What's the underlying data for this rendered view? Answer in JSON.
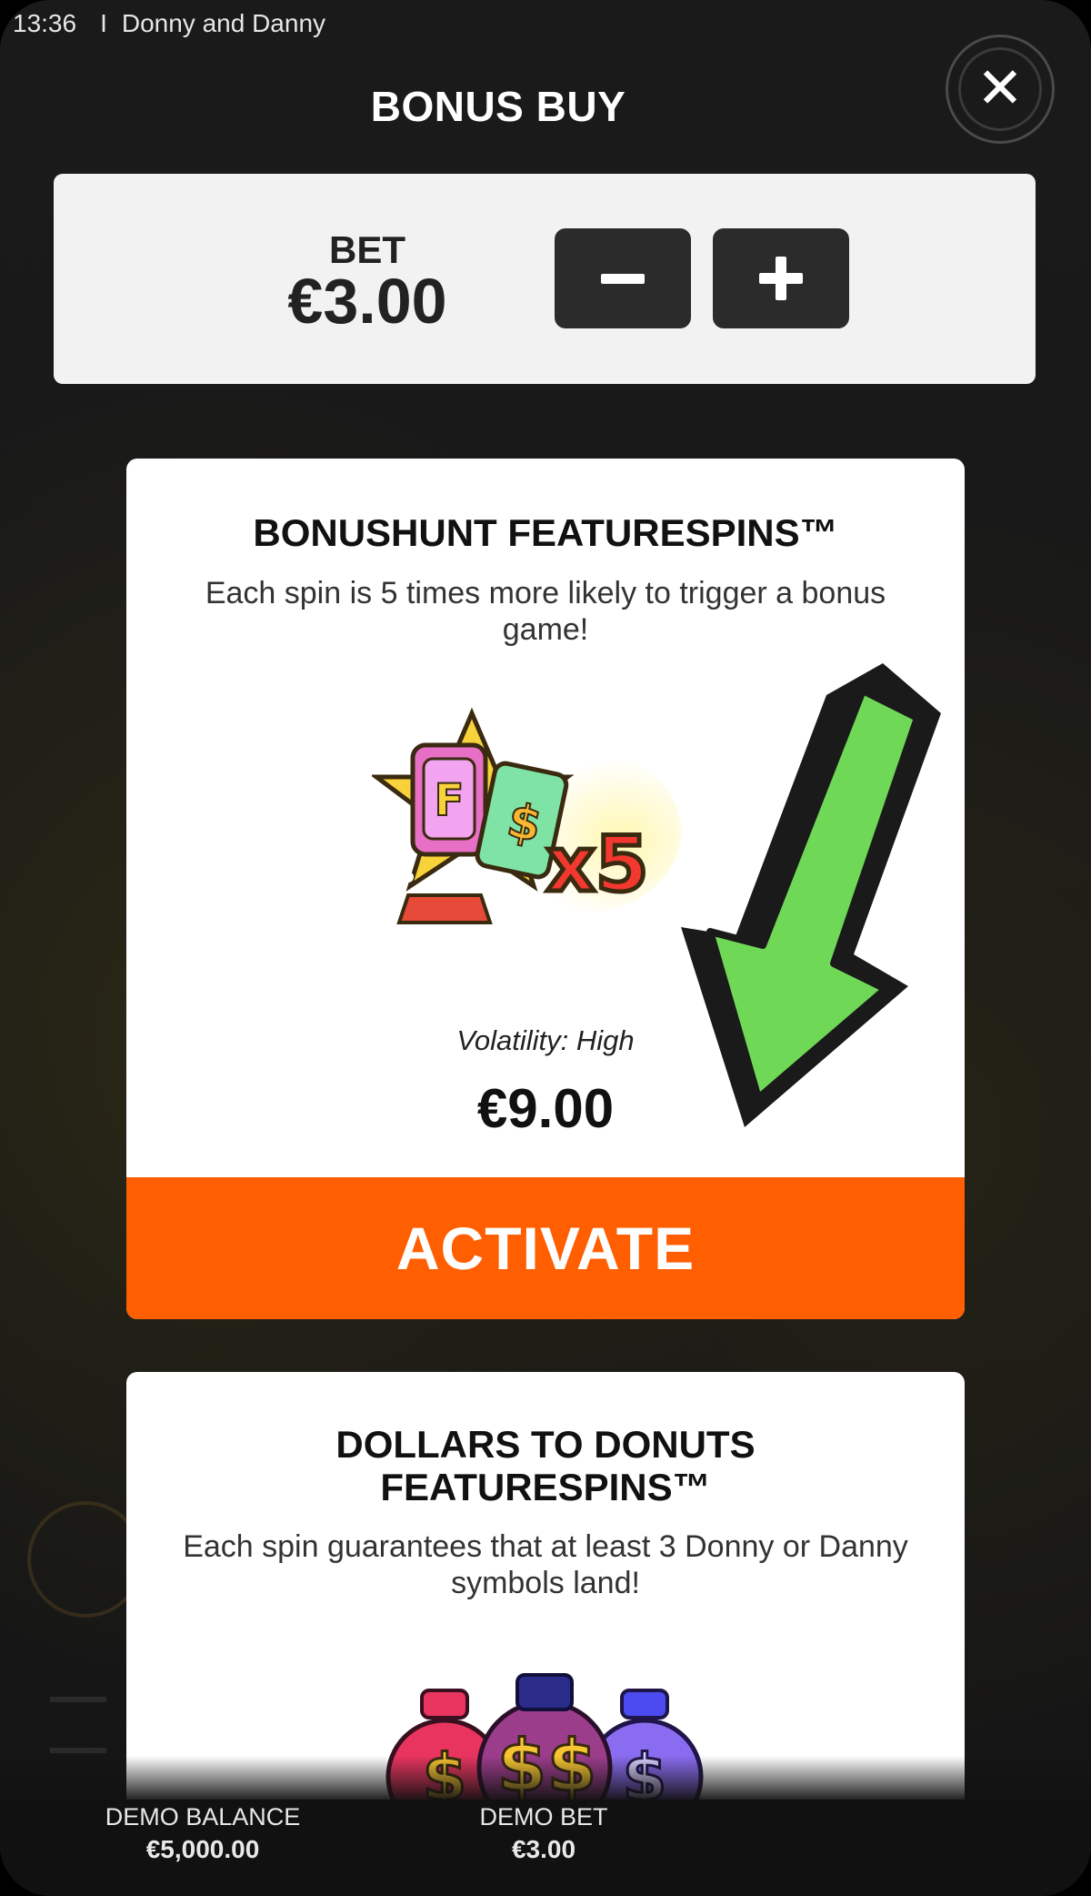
{
  "status_bar": {
    "time": "13:36",
    "separator": "I",
    "game_title": "Donny and Danny"
  },
  "header": {
    "title": "BONUS BUY",
    "close_icon": "close-icon"
  },
  "bet_panel": {
    "label": "BET",
    "value": "€3.00",
    "decrease_icon": "minus-icon",
    "increase_icon": "plus-icon"
  },
  "features": [
    {
      "title": "BONUSHUNT FEATURESPINS™",
      "description": "Each spin is 5 times more likely to trigger a bonus game!",
      "image_icon": "bonushunt-x5-icon",
      "volatility": "Volatility: High",
      "price": "€9.00",
      "activate_label": "ACTIVATE",
      "annotation_icon": "green-arrow-icon"
    },
    {
      "title_line1": "DOLLARS TO DONUTS",
      "title_line2": "FEATURESPINS™",
      "description": "Each spin guarantees that at least 3 Donny or Danny symbols land!",
      "image_icon": "donut-coins-icon"
    }
  ],
  "footer": {
    "balance_label": "DEMO BALANCE",
    "balance_value": "€5,000.00",
    "bet_label": "DEMO BET",
    "bet_value": "€3.00"
  },
  "colors": {
    "accent": "#ff5f00",
    "arrow_green": "#6fd957",
    "panel": "#f2f2f2",
    "background": "#141414"
  }
}
